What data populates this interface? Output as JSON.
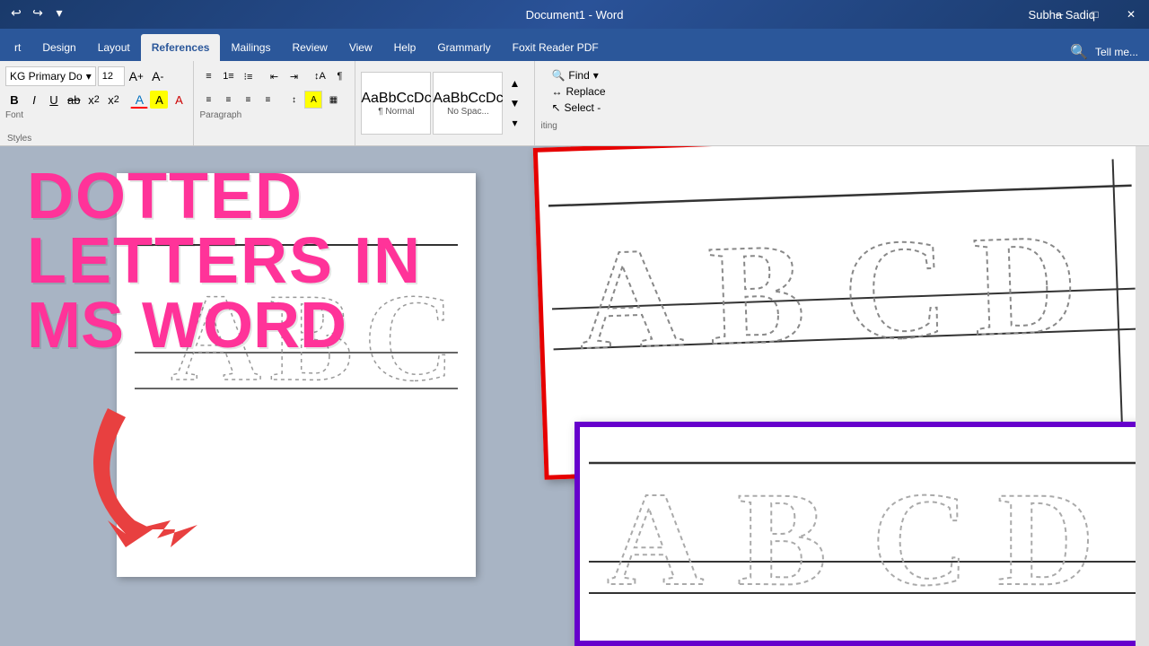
{
  "titlebar": {
    "title": "Document1 - Word",
    "user": "Subha Sadiq",
    "quickaccess": [
      "↩",
      "↪",
      "▾"
    ]
  },
  "ribbon": {
    "tabs": [
      "rt",
      "Design",
      "Layout",
      "References",
      "Mailings",
      "Review",
      "View",
      "Help",
      "Grammarly",
      "Foxit Reader PDF"
    ],
    "active_tab": "References",
    "font_name": "KG Primary Do",
    "font_size": "12",
    "find_label": "Find",
    "replace_label": "Replace",
    "select_label": "Select -",
    "styles": [
      {
        "preview": "AaBbCcDc",
        "label": "¶ Normal"
      },
      {
        "preview": "AaBbCcDc",
        "label": "No Spac..."
      }
    ],
    "groups": {
      "font": "Font",
      "paragraph": "Paragraph",
      "styles": "Styles",
      "editing": "Editing"
    }
  },
  "tutorial": {
    "line1": "DOTTED",
    "line2": "LETTERS IN",
    "line3": "MS WORD"
  },
  "worksheet_red": {
    "letters": [
      "A",
      "B",
      "C",
      "D"
    ]
  },
  "worksheet_purple": {
    "letters": [
      "A",
      "B",
      "C",
      "D"
    ]
  },
  "doc_page": {
    "letters": [
      "A",
      "B",
      "C"
    ]
  },
  "colors": {
    "title_pink": "#ff3399",
    "border_red": "#e60000",
    "border_purple": "#6600cc",
    "arrow_red": "#e84040",
    "ribbon_blue": "#2b579a",
    "bg": "#a8b4c4"
  }
}
